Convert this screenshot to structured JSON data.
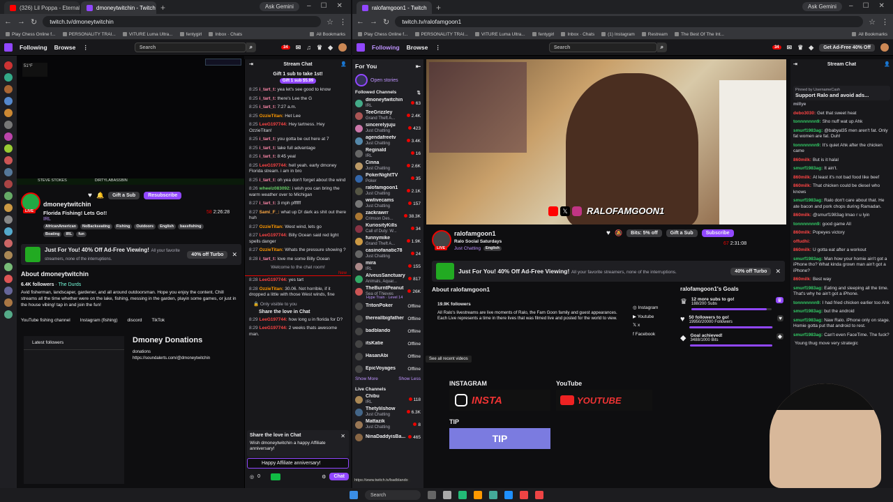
{
  "w1": {
    "tabs": [
      {
        "label": "(326) Lil Poppa - Eternal Living",
        "icon": "yt"
      },
      {
        "label": "dmoneytwitchin - Twitch",
        "icon": "twitch"
      }
    ],
    "ask": "Ask Gemini",
    "url": "twitch.tv/dmoneytwitchin",
    "bookmarks": [
      "Play Chess Online f...",
      "PERSONALITY TRAI...",
      "VITURE Luma Ultra...",
      "fentygirl",
      "Inbox · Chats",
      "All Bookmarks"
    ],
    "nav": {
      "following": "Following",
      "browse": "Browse",
      "search": "Search",
      "notif": "34"
    },
    "channel": {
      "name": "dmoneytwitchin",
      "title": "Florida Fishing! Lets Go!!",
      "cat": "IRL",
      "viewers": "58",
      "uptime": "2:26:28",
      "tags": [
        "AfricanAmerican",
        "NoBackseating",
        "Fishing",
        "Outdoors",
        "English",
        "bassfishing",
        "Boating",
        "IRL",
        "fun"
      ],
      "gift": "Gift a Sub",
      "resub": "Resubscribe",
      "live": "LIVE"
    },
    "overlay": {
      "temp": "51°F",
      "name": "STEVE STOKES",
      "label": "DIRTYLABASSBIN"
    },
    "promo": {
      "title": "Just For You! 40% Off Ad-Free Viewing!",
      "sub": "All your favorite streamers, none of the interruptions.",
      "btn": "40% off Turbo"
    },
    "about": {
      "title": "About dmoneytwitchin",
      "followers": "6.4K followers",
      "team": "· The Durds",
      "desc": "Avid fisherman, landscaper, gardener, and all around outdoorsman. Hope you enjoy the content. Chill streams all the time whether were on the lake, fishing, messing in the garden, playin some games, or just in the house vibing! tap in and join the fun!",
      "links": [
        "YouTube fishing channel",
        "Instagram (fishing)",
        "discord",
        "TikTok"
      ]
    },
    "panel": {
      "latest": "Latest followers",
      "donations_title": "Dmoney Donations",
      "donations": "donations",
      "donations_url": "https://soundalerts.com/@dmoneytwitchin"
    },
    "chat": {
      "title": "Stream Chat",
      "gift_text": "Gift 1 sub to take 1st!",
      "gift_btn": "Gift 1 sub",
      "gift_price": "$5.99",
      "lines": [
        {
          "t": "8:25",
          "u": "i_tart_t:",
          "c": "#f8a",
          "m": "yea let's see good to know"
        },
        {
          "t": "8:25",
          "u": "i_tart_t:",
          "c": "#f8a",
          "m": "there's Lee the G"
        },
        {
          "t": "8:25",
          "u": "i_tart_t:",
          "c": "#f8a",
          "m": "7:27 a.m."
        },
        {
          "t": "8:25",
          "u": "OzzieTitan:",
          "c": "#f90",
          "m": "Het Lee"
        },
        {
          "t": "8:25",
          "u": "LeeG197744:",
          "c": "#f44",
          "m": "Hey tartness. Hey OzzieTitan!"
        },
        {
          "t": "8:25",
          "u": "i_tart_t:",
          "c": "#f8a",
          "m": "you gotta be out here at 7"
        },
        {
          "t": "8:25",
          "u": "i_tart_t:",
          "c": "#f8a",
          "m": "take full advantage"
        },
        {
          "t": "8:25",
          "u": "i_tart_t:",
          "c": "#f8a",
          "m": "8:45 yeal"
        },
        {
          "t": "8:25",
          "u": "LeeG197744:",
          "c": "#f44",
          "m": "hell yeah. early dmoney Florida stream. i am in bro"
        },
        {
          "t": "8:25",
          "u": "i_tart_t:",
          "c": "#f8a",
          "m": "oh yea don't forget about the wind"
        },
        {
          "t": "8:26",
          "u": "wheelz083092:",
          "c": "#6c6",
          "m": "i wish you can bring the warm weather over to Michigan"
        },
        {
          "t": "8:27",
          "u": "i_tart_t:",
          "c": "#f8a",
          "m": "3 mph pffffff"
        },
        {
          "t": "8:27",
          "u": "Sami_F_:",
          "c": "#fa4",
          "m": "what up D! dark as shit out there huh"
        },
        {
          "t": "8:27",
          "u": "OzzieTitan:",
          "c": "#f90",
          "m": "West wind, lets go"
        },
        {
          "t": "8:27",
          "u": "LeeG197744:",
          "c": "#f44",
          "m": "Billy Ocean said red light spells danger"
        },
        {
          "t": "8:27",
          "u": "OzzieTitan:",
          "c": "#f90",
          "m": "Whats the pressure showing ?"
        },
        {
          "t": "8:28",
          "u": "i_tart_t:",
          "c": "#f8a",
          "m": "love me some Billy Ocean"
        }
      ],
      "welcome": "Welcome to the chat room!",
      "new": "New",
      "lines2": [
        {
          "t": "8:28",
          "u": "LeeG197744:",
          "c": "#f44",
          "m": "yes tart"
        },
        {
          "t": "8:28",
          "u": "OzzieTitan:",
          "c": "#f90",
          "m": "30.06. Not horrible, if it dropped a little with those West winds, fine"
        }
      ],
      "visible": "Only visible to you",
      "share": "Share the love in Chat",
      "lines3": [
        {
          "t": "8:29",
          "u": "LeeG197744:",
          "c": "#f44",
          "m": "how long u in florida for D?"
        },
        {
          "t": "8:29",
          "u": "LeeG197744:",
          "c": "#f44",
          "m": "2 weeks thats awesome man."
        }
      ],
      "share_title": "Share the love in Chat",
      "share_msg": "Wish dmoneytwitchin a happy Affiliate anniversary!",
      "anniv": "Happy Affiliate anniversary!",
      "points": "0",
      "btn": "Chat"
    }
  },
  "w2": {
    "tabs": [
      {
        "label": "ralofamgoon1 - Twitch",
        "icon": "twitch"
      }
    ],
    "ask": "Ask Gemini",
    "url": "twitch.tv/ralofamgoon1",
    "bookmarks": [
      "Play Chess Online f...",
      "PERSONALITY TRAI...",
      "VITURE Luma Ultra...",
      "fentygirl",
      "Inbox · Chats",
      "(1) Instagram",
      "Restream",
      "The Best Of The Int...",
      "All Bookmarks"
    ],
    "nav": {
      "following": "Following",
      "browse": "Browse",
      "search": "Search",
      "notif": "34",
      "adfree": "Get Ad-Free 40% Off"
    },
    "sidebar": {
      "title": "For You",
      "stories": "Open stories",
      "followed": "Followed Channels",
      "items": [
        {
          "n": "dmoneytwitchin",
          "g": "IRL",
          "v": "63"
        },
        {
          "n": "TeeGrizzley",
          "g": "Grand Theft A...",
          "v": "2.4K"
        },
        {
          "n": "sincerelyjuju",
          "g": "Just Chatting",
          "v": "423"
        },
        {
          "n": "agendafreetv",
          "g": "Just Chatting",
          "v": "3.4K"
        },
        {
          "n": "Reginald",
          "g": "IRL",
          "v": "16"
        },
        {
          "n": "Cinna",
          "g": "Just Chatting",
          "v": "2.6K"
        },
        {
          "n": "PokerNightTV",
          "g": "Poker",
          "v": "35"
        },
        {
          "n": "ralofamgoon1",
          "g": "Just Chatting",
          "v": "2.1K"
        },
        {
          "n": "wwlivecams",
          "g": "Just Chatting",
          "v": "157"
        },
        {
          "n": "zackrawrr",
          "g": "Crimson Des...",
          "v": "38.3K"
        },
        {
          "n": "KuriosityKills",
          "g": "Call of Duty: W...",
          "v": "34"
        },
        {
          "n": "funnymike",
          "g": "Grand Theft A...",
          "v": "1.9K"
        },
        {
          "n": "casinofanatic78",
          "g": "Just Chatting",
          "v": "24"
        },
        {
          "n": "mira",
          "g": "IRL",
          "v": "155"
        },
        {
          "n": "AlveusSanctuary",
          "g": "Animals, Aquar...",
          "v": "817"
        },
        {
          "n": "TheBurntPeanut",
          "g": "Sea of Thieves",
          "v": "26K"
        }
      ],
      "hype": "Hype Train · Level 14",
      "offline": [
        {
          "n": "TritonPoker",
          "v": "Offline"
        },
        {
          "n": "thereallbigfather",
          "v": "Offline"
        },
        {
          "n": "badblando",
          "v": "Offline"
        },
        {
          "n": "itsKatie",
          "v": "Offline"
        },
        {
          "n": "HasanAbi",
          "v": "Offline"
        },
        {
          "n": "EpicVoyages",
          "v": "Offline"
        }
      ],
      "more": "Show More",
      "less": "Show Less",
      "live": "Live Channels",
      "live_items": [
        {
          "n": "Chibu",
          "g": "IRL",
          "v": "118"
        },
        {
          "n": "Thetylilshow",
          "g": "Just Chatting",
          "v": "6.3K"
        },
        {
          "n": "Mattazik",
          "g": "Just Chatting",
          "v": "8"
        },
        {
          "n": "NinaDaddyisBa...",
          "g": "",
          "v": "465"
        }
      ],
      "status": "https://www.twitch.tv/badblando"
    },
    "video": {
      "overlay": "RALOFAMGOON1"
    },
    "channel": {
      "name": "ralofamgoon1",
      "title": "Ralo Social Saturdays",
      "cat": "Just Chatting",
      "lang": "English",
      "viewers": "67",
      "uptime": "2:31:08",
      "bits": "Bits: 5% off",
      "gift": "Gift a Sub",
      "sub": "Subscribe",
      "live": "LIVE"
    },
    "promo": {
      "title": "Just For You! 40% Off Ad-Free Viewing!",
      "sub": "All your favorite streamers, none of the interruptions.",
      "btn": "40% off Turbo"
    },
    "about": {
      "title": "About ralofamgoon1",
      "followers": "19.9K followers",
      "desc": "All Ralo's livestreams are live moments of Ralo, the Fam Goon family and guest appearances. Each Live represents a time in there lives that was filmed live and posted for the world to view.",
      "links": [
        "Instagram",
        "Youtube",
        "x",
        "Facebook"
      ]
    },
    "tooltip": "See all recent videos",
    "goals": {
      "title": "ralofamgoon1's Goals",
      "items": [
        {
          "l": "12 more subs to go!",
          "s": "188/200 Subs",
          "p": 0.94
        },
        {
          "l": "50 followers to go!",
          "s": "19950/20000 Followers",
          "p": 0.99
        },
        {
          "l": "Goal achieved!",
          "s": "3488/1000 Bits",
          "p": 1.0
        }
      ]
    },
    "panels": {
      "insta_h": "INSTAGRAM",
      "insta": "INSTA",
      "yt_h": "YouTube",
      "yt": "YOUTUBE",
      "tip_h": "TIP",
      "tip": "TIP"
    },
    "chat": {
      "title": "Stream Chat",
      "pinned": "Pinned by",
      "pinned_user": "UsernameCash",
      "pinned_msg": "Support Ralo and avoid ads...",
      "lines": [
        {
          "u": "millye",
          "c": "#adadb8",
          "m": ""
        },
        {
          "u": "debo3030:",
          "c": "#f44",
          "m": "Get that sweet heat"
        },
        {
          "u": "tonnnnnnn9:",
          "c": "#3c6",
          "m": "Sho nuff wat up Ahk"
        },
        {
          "u": "smurf1983ag:",
          "c": "#3c6",
          "m": "@babyal35 men aren't fat. Only fat women are fat. Duh!"
        },
        {
          "u": "tonnnnnnn9:",
          "c": "#3c6",
          "m": "It's quiet Ahk after the chicken came"
        },
        {
          "u": "860milk:",
          "c": "#f44",
          "m": "But is it halal"
        },
        {
          "u": "smurf1983ag:",
          "c": "#3c6",
          "m": "It ain't."
        },
        {
          "u": "860milk:",
          "c": "#f44",
          "m": "At least it's not bad food like beef"
        },
        {
          "u": "860milk:",
          "c": "#f44",
          "m": "That chicken could be dieseI who knows"
        },
        {
          "u": "smurf1983ag:",
          "c": "#3c6",
          "m": "Ralo don't care about that. He ate bacon and pork chops during Ramadan."
        },
        {
          "u": "860milk:",
          "c": "#f44",
          "m": "@smurf1983ag lmao r u lyin"
        },
        {
          "u": "tonnnnnnn9:",
          "c": "#3c6",
          "m": "good game All"
        },
        {
          "u": "860milk:",
          "c": "#f44",
          "m": "Popeyes victory"
        },
        {
          "u": "offudhi:",
          "c": "#f44",
          "m": ""
        },
        {
          "u": "860milk:",
          "c": "#f44",
          "m": "U gotta eat after a workout"
        },
        {
          "u": "smurf1983ag:",
          "c": "#3c6",
          "m": "Man how your homie ain't got a iPhone tho? What kinda grown man ain't got a iPhone?"
        },
        {
          "u": "860milk:",
          "c": "#f44",
          "m": "Best way"
        },
        {
          "u": "smurf1983ag:",
          "c": "#3c6",
          "m": "Eating and sleeping all the time. That's why he ain't got a iPhone."
        },
        {
          "u": "tonnnnnnn9:",
          "c": "#3c6",
          "m": "I had fried chicken earlier too Ahk"
        },
        {
          "u": "smurf1983ag:",
          "c": "#3c6",
          "m": "but the android"
        },
        {
          "u": "smurf1983ag:",
          "c": "#3c6",
          "m": "Naw Ralo. iPhone only on stage. Homie gotta put that android to rest."
        },
        {
          "u": "smurf1983ag:",
          "c": "#3c6",
          "m": "Can't even FaceTime. The fuck?"
        },
        {
          "u": "",
          "c": "#adadb8",
          "m": "Young thug move very strategic"
        }
      ]
    }
  },
  "taskbar": {
    "search": "Search"
  }
}
